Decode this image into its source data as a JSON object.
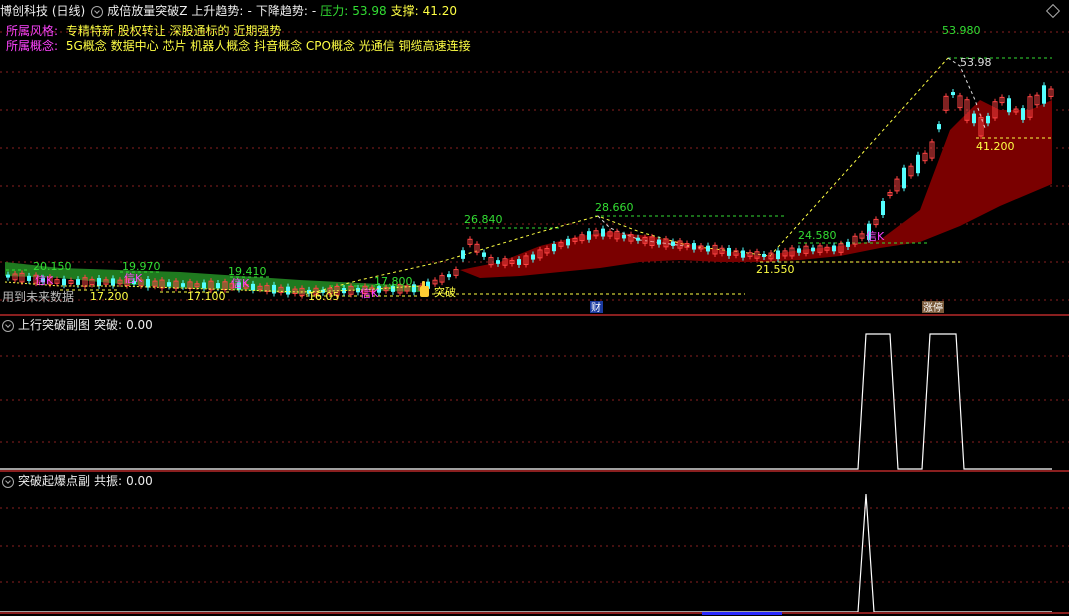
{
  "main": {
    "stock_title": "博创科技 (日线)",
    "indicator_name": "成倍放量突破Z",
    "up_trend_label": "上升趋势:",
    "up_trend_value": "-",
    "down_trend_label": "下降趋势:",
    "down_trend_value": "-",
    "pressure_label": "压力:",
    "pressure_value": "53.98",
    "support_label": "支撑:",
    "support_value": "41.20",
    "style_label": "所属风格:",
    "style_value": "专精特新 股权转让 深股通标的 近期强势",
    "concept_label": "所属概念:",
    "concept_value": "5G概念 数据中心 芯片 机器人概念 抖音概念 CPO概念 光通信 铜缆高速连接",
    "future_data_label": "用到未来数据",
    "price_labels": [
      {
        "text": "20.150",
        "color": "#33dd33"
      },
      {
        "text": "19.970",
        "color": "#33dd33"
      },
      {
        "text": "19.410",
        "color": "#33dd33"
      },
      {
        "text": "17.800",
        "color": "#33dd33"
      },
      {
        "text": "26.840",
        "color": "#33dd33"
      },
      {
        "text": "28.660",
        "color": "#33dd33"
      },
      {
        "text": "24.580",
        "color": "#33dd33"
      },
      {
        "text": "53.980",
        "color": "#33dd33"
      },
      {
        "text": "17.200",
        "color": "#ffff44"
      },
      {
        "text": "17.100",
        "color": "#ffff44"
      },
      {
        "text": "16.05",
        "color": "#ffff44"
      },
      {
        "text": "21.550",
        "color": "#ffff44"
      },
      {
        "text": "41.200",
        "color": "#ffff44"
      },
      {
        "text": "53.98",
        "color": "#dddddd"
      }
    ],
    "signals": [
      "信K",
      "信K",
      "信K",
      "信K",
      "信K",
      "突破"
    ],
    "events": [
      "财",
      "涨停"
    ]
  },
  "sub1": {
    "name": "上行突破副图",
    "value_label": "突破:",
    "value": "0.00"
  },
  "sub2": {
    "name": "突破起爆点副",
    "value_label": "共振:",
    "value": "0.00"
  },
  "colors": {
    "up_candle": "#ff4444",
    "down_candle": "#54ffff",
    "trend_fill": "#7a0000",
    "green_fill": "#1f7a1f",
    "grid": "#8a1f1f",
    "yellow": "#ffff44",
    "green": "#33dd33",
    "magenta": "#ff44ff"
  }
}
